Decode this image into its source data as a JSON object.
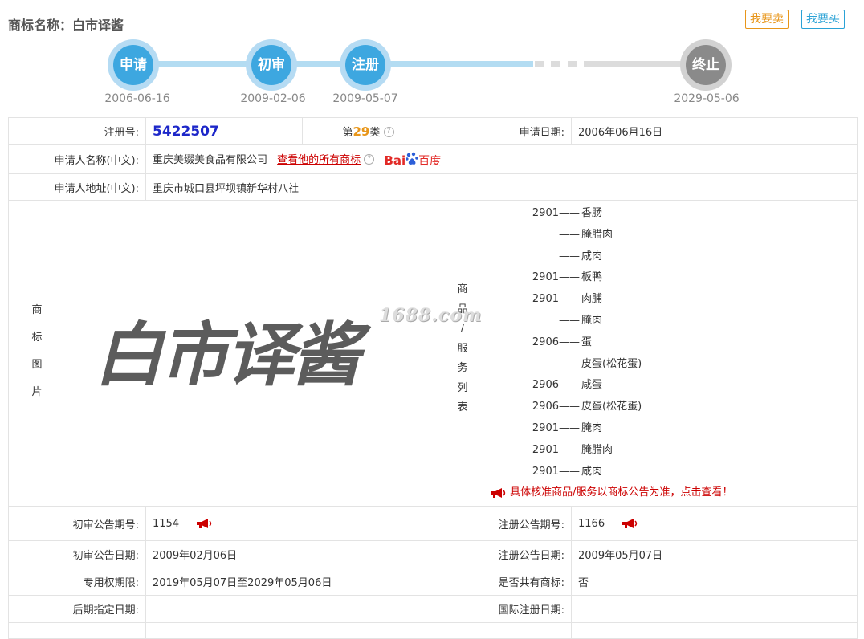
{
  "header": {
    "title": "商标名称：白市译酱",
    "sell_label": "我要卖",
    "buy_label": "我要买"
  },
  "timeline": {
    "steps": [
      {
        "label": "申请",
        "date": "2006-06-16"
      },
      {
        "label": "初审",
        "date": "2009-02-06"
      },
      {
        "label": "注册",
        "date": "2009-05-07"
      },
      {
        "label": "终止",
        "date": "2029-05-06"
      }
    ]
  },
  "colors": {
    "accent_blue": "#3da7e0",
    "accent_orange": "#e8961a",
    "link_red": "#cc0000",
    "regno_blue": "#1d27c9"
  },
  "details": {
    "reg_no_label": "注册号:",
    "reg_no": "5422507",
    "class_prefix": "第",
    "class_num": "29",
    "class_suffix": "类",
    "apply_date_label": "申请日期:",
    "apply_date": "2006年06月16日",
    "applicant_label": "申请人名称(中文):",
    "applicant": "重庆美缀美食品有限公司",
    "view_all": "查看他的所有商标",
    "baidu_a": "Bai",
    "baidu_b": "百度",
    "address_label": "申请人地址(中文):",
    "address": "重庆市城口县坪坝镇新华村八社",
    "image_label_chars": [
      "商",
      "标",
      "图",
      "片"
    ],
    "trademark_text": "白市译酱",
    "watermark": "1688.com",
    "goods_label_chars": [
      "商",
      "品",
      "/",
      "服",
      "务",
      "列",
      "表"
    ],
    "goods": [
      {
        "code": "2901",
        "name": "香肠"
      },
      {
        "code": "",
        "name": "腌腊肉"
      },
      {
        "code": "",
        "name": "咸肉"
      },
      {
        "code": "2901",
        "name": "板鸭"
      },
      {
        "code": "2901",
        "name": "肉脯"
      },
      {
        "code": "",
        "name": "腌肉"
      },
      {
        "code": "2906",
        "name": "蛋"
      },
      {
        "code": "",
        "name": "皮蛋(松花蛋)"
      },
      {
        "code": "2906",
        "name": "咸蛋"
      },
      {
        "code": "2906",
        "name": "皮蛋(松花蛋)"
      },
      {
        "code": "2901",
        "name": "腌肉"
      },
      {
        "code": "2901",
        "name": "腌腊肉"
      },
      {
        "code": "2901",
        "name": "咸肉"
      }
    ],
    "goods_dash": "——",
    "goods_notice": "具体核准商品/服务以商标公告为准，点击查看！",
    "prelim_no_label": "初审公告期号:",
    "prelim_no": "1154",
    "reg_notice_no_label": "注册公告期号:",
    "reg_notice_no": "1166",
    "prelim_date_label": "初审公告日期:",
    "prelim_date": "2009年02月06日",
    "reg_notice_date_label": "注册公告日期:",
    "reg_notice_date": "2009年05月07日",
    "exclusive_label": "专用权期限:",
    "exclusive": "2019年05月07日至2029年05月06日",
    "shared_label": "是否共有商标:",
    "shared": "否",
    "later_label": "后期指定日期:",
    "later": "",
    "intl_label": "国际注册日期:",
    "intl": ""
  }
}
